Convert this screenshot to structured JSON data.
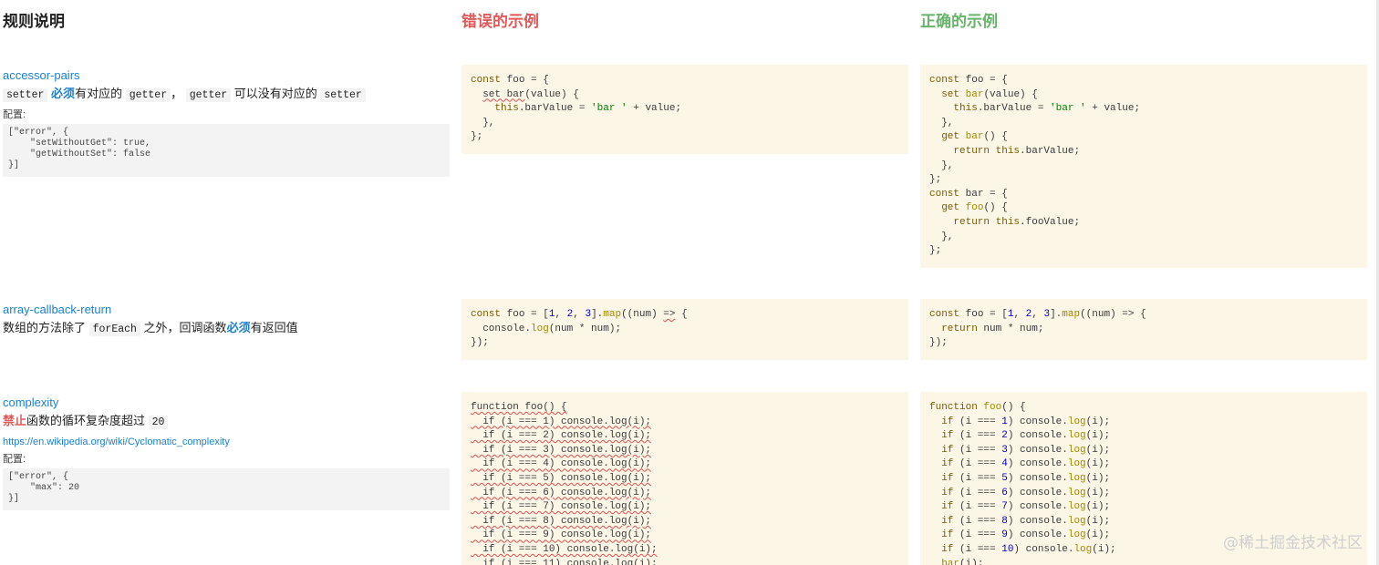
{
  "headers": {
    "rule": "规则说明",
    "bad": "错误的示例",
    "good": "正确的示例"
  },
  "rules": [
    {
      "name": "accessor-pairs",
      "desc": [
        {
          "t": "code",
          "v": "setter"
        },
        {
          "t": "text",
          "v": " "
        },
        {
          "t": "blue",
          "v": "必须"
        },
        {
          "t": "text",
          "v": "有对应的 "
        },
        {
          "t": "code",
          "v": "getter"
        },
        {
          "t": "text",
          "v": "， "
        },
        {
          "t": "code",
          "v": "getter"
        },
        {
          "t": "text",
          "v": " 可以没有对应的 "
        },
        {
          "t": "code",
          "v": "setter"
        }
      ],
      "link": "",
      "config_label": "配置:",
      "config": "[\"error\", {\n    \"setWithoutGet\": true,\n    \"getWithoutSet\": false\n}]"
    },
    {
      "name": "array-callback-return",
      "desc": [
        {
          "t": "text",
          "v": "数组的方法除了 "
        },
        {
          "t": "code",
          "v": "forEach"
        },
        {
          "t": "text",
          "v": " 之外，回调函数"
        },
        {
          "t": "blue",
          "v": "必须"
        },
        {
          "t": "text",
          "v": "有返回值"
        }
      ],
      "link": "",
      "config_label": "",
      "config": ""
    },
    {
      "name": "complexity",
      "desc": [
        {
          "t": "red",
          "v": "禁止"
        },
        {
          "t": "text",
          "v": "函数的循环复杂度超过 "
        },
        {
          "t": "code",
          "v": "20"
        }
      ],
      "link": "https://en.wikipedia.org/wiki/Cyclomatic_complexity",
      "config_label": "配置:",
      "config": "[\"error\", {\n    \"max\": 20\n}]"
    }
  ],
  "examples": {
    "accessor_bad": [
      [
        [
          "kw",
          "const"
        ],
        [
          "plain",
          " foo = {"
        ]
      ],
      [
        [
          "plain",
          "  "
        ],
        [
          "sq",
          "set bar"
        ],
        [
          "plain",
          "(value) {"
        ]
      ],
      [
        [
          "plain",
          "    "
        ],
        [
          "kw",
          "this"
        ],
        [
          "plain",
          ".barValue = "
        ],
        [
          "str",
          "'bar '"
        ],
        [
          "plain",
          " + value;"
        ]
      ],
      [
        [
          "plain",
          "  },"
        ]
      ],
      [
        [
          "plain",
          "};"
        ]
      ]
    ],
    "accessor_good": [
      [
        [
          "kw",
          "const"
        ],
        [
          "plain",
          " foo = {"
        ]
      ],
      [
        [
          "plain",
          "  "
        ],
        [
          "kw",
          "set"
        ],
        [
          "plain",
          " "
        ],
        [
          "fn",
          "bar"
        ],
        [
          "plain",
          "(value) {"
        ]
      ],
      [
        [
          "plain",
          "    "
        ],
        [
          "kw",
          "this"
        ],
        [
          "plain",
          ".barValue = "
        ],
        [
          "str",
          "'bar '"
        ],
        [
          "plain",
          " + value;"
        ]
      ],
      [
        [
          "plain",
          "  },"
        ]
      ],
      [
        [
          "plain",
          "  "
        ],
        [
          "kw",
          "get"
        ],
        [
          "plain",
          " "
        ],
        [
          "fn",
          "bar"
        ],
        [
          "plain",
          "() {"
        ]
      ],
      [
        [
          "plain",
          "    "
        ],
        [
          "kw",
          "return"
        ],
        [
          "plain",
          " "
        ],
        [
          "kw",
          "this"
        ],
        [
          "plain",
          ".barValue;"
        ]
      ],
      [
        [
          "plain",
          "  },"
        ]
      ],
      [
        [
          "plain",
          "};"
        ]
      ],
      [
        [
          "kw",
          "const"
        ],
        [
          "plain",
          " bar = {"
        ]
      ],
      [
        [
          "plain",
          "  "
        ],
        [
          "kw",
          "get"
        ],
        [
          "plain",
          " "
        ],
        [
          "fn",
          "foo"
        ],
        [
          "plain",
          "() {"
        ]
      ],
      [
        [
          "plain",
          "    "
        ],
        [
          "kw",
          "return"
        ],
        [
          "plain",
          " "
        ],
        [
          "kw",
          "this"
        ],
        [
          "plain",
          ".fooValue;"
        ]
      ],
      [
        [
          "plain",
          "  },"
        ]
      ],
      [
        [
          "plain",
          "};"
        ]
      ]
    ],
    "array_bad": [
      [
        [
          "kw",
          "const"
        ],
        [
          "plain",
          " foo = ["
        ],
        [
          "num",
          "1"
        ],
        [
          "plain",
          ", "
        ],
        [
          "num",
          "2"
        ],
        [
          "plain",
          ", "
        ],
        [
          "num",
          "3"
        ],
        [
          "plain",
          "]."
        ],
        [
          "fn",
          "map"
        ],
        [
          "plain",
          "((num) "
        ],
        [
          "sq",
          "=>"
        ],
        [
          "plain",
          " {"
        ]
      ],
      [
        [
          "plain",
          "  console."
        ],
        [
          "fn",
          "log"
        ],
        [
          "plain",
          "(num * num);"
        ]
      ],
      [
        [
          "plain",
          "});"
        ]
      ]
    ],
    "array_good": [
      [
        [
          "kw",
          "const"
        ],
        [
          "plain",
          " foo = ["
        ],
        [
          "num",
          "1"
        ],
        [
          "plain",
          ", "
        ],
        [
          "num",
          "2"
        ],
        [
          "plain",
          ", "
        ],
        [
          "num",
          "3"
        ],
        [
          "plain",
          "]."
        ],
        [
          "fn",
          "map"
        ],
        [
          "plain",
          "((num) => {"
        ]
      ],
      [
        [
          "plain",
          "  "
        ],
        [
          "kw",
          "return"
        ],
        [
          "plain",
          " num * num;"
        ]
      ],
      [
        [
          "plain",
          "});"
        ]
      ]
    ],
    "complexity_bad": [
      [
        [
          "sq",
          "function foo() {"
        ]
      ],
      [
        [
          "sq",
          "  if (i === 1) console.log(i);"
        ]
      ],
      [
        [
          "sq",
          "  if (i === 2) console.log(i);"
        ]
      ],
      [
        [
          "sq",
          "  if (i === 3) console.log(i);"
        ]
      ],
      [
        [
          "sq",
          "  if (i === 4) console.log(i);"
        ]
      ],
      [
        [
          "sq",
          "  if (i === 5) console.log(i);"
        ]
      ],
      [
        [
          "sq",
          "  if (i === 6) console.log(i);"
        ]
      ],
      [
        [
          "sq",
          "  if (i === 7) console.log(i);"
        ]
      ],
      [
        [
          "sq",
          "  if (i === 8) console.log(i);"
        ]
      ],
      [
        [
          "sq",
          "  if (i === 9) console.log(i);"
        ]
      ],
      [
        [
          "sq",
          "  if (i === 10) console.log(i);"
        ]
      ],
      [
        [
          "plain",
          "  if (i === 11) console.log(i);"
        ]
      ]
    ],
    "complexity_good": [
      [
        [
          "kw",
          "function"
        ],
        [
          "plain",
          " "
        ],
        [
          "fn",
          "foo"
        ],
        [
          "plain",
          "() {"
        ]
      ],
      [
        [
          "plain",
          "  "
        ],
        [
          "kw",
          "if"
        ],
        [
          "plain",
          " (i === "
        ],
        [
          "num",
          "1"
        ],
        [
          "plain",
          ") console."
        ],
        [
          "fn",
          "log"
        ],
        [
          "plain",
          "(i);"
        ]
      ],
      [
        [
          "plain",
          "  "
        ],
        [
          "kw",
          "if"
        ],
        [
          "plain",
          " (i === "
        ],
        [
          "num",
          "2"
        ],
        [
          "plain",
          ") console."
        ],
        [
          "fn",
          "log"
        ],
        [
          "plain",
          "(i);"
        ]
      ],
      [
        [
          "plain",
          "  "
        ],
        [
          "kw",
          "if"
        ],
        [
          "plain",
          " (i === "
        ],
        [
          "num",
          "3"
        ],
        [
          "plain",
          ") console."
        ],
        [
          "fn",
          "log"
        ],
        [
          "plain",
          "(i);"
        ]
      ],
      [
        [
          "plain",
          "  "
        ],
        [
          "kw",
          "if"
        ],
        [
          "plain",
          " (i === "
        ],
        [
          "num",
          "4"
        ],
        [
          "plain",
          ") console."
        ],
        [
          "fn",
          "log"
        ],
        [
          "plain",
          "(i);"
        ]
      ],
      [
        [
          "plain",
          "  "
        ],
        [
          "kw",
          "if"
        ],
        [
          "plain",
          " (i === "
        ],
        [
          "num",
          "5"
        ],
        [
          "plain",
          ") console."
        ],
        [
          "fn",
          "log"
        ],
        [
          "plain",
          "(i);"
        ]
      ],
      [
        [
          "plain",
          "  "
        ],
        [
          "kw",
          "if"
        ],
        [
          "plain",
          " (i === "
        ],
        [
          "num",
          "6"
        ],
        [
          "plain",
          ") console."
        ],
        [
          "fn",
          "log"
        ],
        [
          "plain",
          "(i);"
        ]
      ],
      [
        [
          "plain",
          "  "
        ],
        [
          "kw",
          "if"
        ],
        [
          "plain",
          " (i === "
        ],
        [
          "num",
          "7"
        ],
        [
          "plain",
          ") console."
        ],
        [
          "fn",
          "log"
        ],
        [
          "plain",
          "(i);"
        ]
      ],
      [
        [
          "plain",
          "  "
        ],
        [
          "kw",
          "if"
        ],
        [
          "plain",
          " (i === "
        ],
        [
          "num",
          "8"
        ],
        [
          "plain",
          ") console."
        ],
        [
          "fn",
          "log"
        ],
        [
          "plain",
          "(i);"
        ]
      ],
      [
        [
          "plain",
          "  "
        ],
        [
          "kw",
          "if"
        ],
        [
          "plain",
          " (i === "
        ],
        [
          "num",
          "9"
        ],
        [
          "plain",
          ") console."
        ],
        [
          "fn",
          "log"
        ],
        [
          "plain",
          "(i);"
        ]
      ],
      [
        [
          "plain",
          "  "
        ],
        [
          "kw",
          "if"
        ],
        [
          "plain",
          " (i === "
        ],
        [
          "num",
          "10"
        ],
        [
          "plain",
          ") console."
        ],
        [
          "fn",
          "log"
        ],
        [
          "plain",
          "(i);"
        ]
      ],
      [
        [
          "plain",
          "  "
        ],
        [
          "fn",
          "bar"
        ],
        [
          "plain",
          "(i);"
        ]
      ]
    ]
  },
  "watermark": "@稀土掘金技术社区"
}
